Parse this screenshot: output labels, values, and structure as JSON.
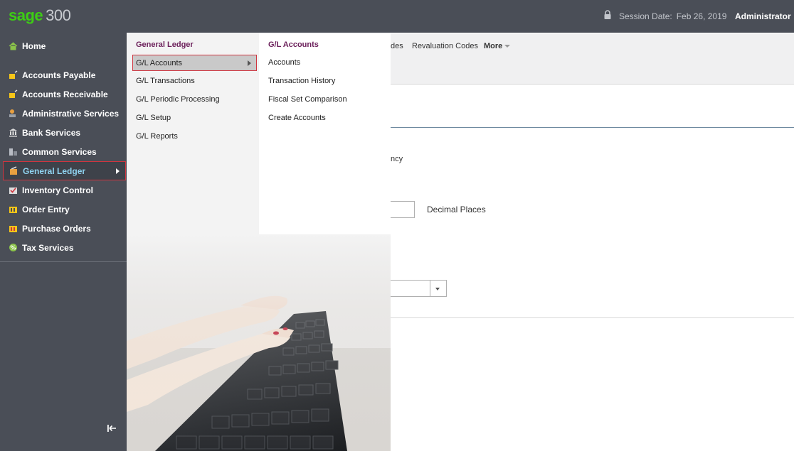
{
  "app": {
    "brand": "sage",
    "version": "300"
  },
  "header": {
    "session_label": "Session Date:",
    "session_date": "Feb 26, 2019",
    "user": "Administrator"
  },
  "sidebar": {
    "items": [
      {
        "label": "Home",
        "icon": "home-icon"
      },
      {
        "label": "Accounts Payable",
        "icon": "accounts-payable-icon"
      },
      {
        "label": "Accounts Receivable",
        "icon": "accounts-receivable-icon"
      },
      {
        "label": "Administrative Services",
        "icon": "admin-services-icon"
      },
      {
        "label": "Bank Services",
        "icon": "bank-icon"
      },
      {
        "label": "Common Services",
        "icon": "common-services-icon"
      },
      {
        "label": "General Ledger",
        "icon": "general-ledger-icon",
        "active": true
      },
      {
        "label": "Inventory Control",
        "icon": "inventory-icon"
      },
      {
        "label": "Order Entry",
        "icon": "order-entry-icon"
      },
      {
        "label": "Purchase Orders",
        "icon": "purchase-orders-icon"
      },
      {
        "label": "Tax Services",
        "icon": "tax-services-icon"
      }
    ]
  },
  "menu1": {
    "title": "General Ledger",
    "items": [
      {
        "label": "G/L Accounts",
        "selected": true
      },
      {
        "label": "G/L Transactions"
      },
      {
        "label": "G/L Periodic Processing"
      },
      {
        "label": "G/L Setup"
      },
      {
        "label": "G/L Reports"
      }
    ]
  },
  "menu2": {
    "title": "G/L Accounts",
    "items": [
      {
        "label": "Accounts"
      },
      {
        "label": "Transaction History"
      },
      {
        "label": "Fiscal Set Comparison"
      },
      {
        "label": "Create Accounts"
      }
    ]
  },
  "background": {
    "tab_partial": "des",
    "tab_revaluation": "Revaluation Codes",
    "more": "More",
    "ency_fragment": "ncy",
    "decimal_places": "Decimal Places"
  },
  "colors": {
    "topbar": "#4a4e57",
    "brand_green": "#3dcd14",
    "highlight_border": "#d0353f",
    "menu_title": "#6b1f5a",
    "active_label": "#8fd3f0"
  }
}
